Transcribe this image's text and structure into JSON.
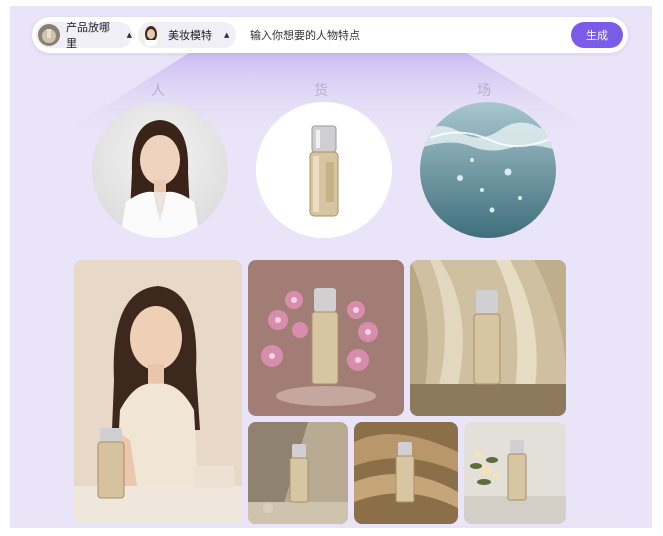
{
  "toolbar": {
    "product_selector_label": "产品放哪里",
    "model_selector_label": "美妆模特",
    "prompt_text": "输入你想要的人物特点",
    "generate_label": "生成"
  },
  "categories": {
    "person": "人",
    "goods": "货",
    "scene": "场"
  },
  "colors": {
    "accent": "#7b5ce8",
    "panel_background": "#e9e4f7"
  }
}
